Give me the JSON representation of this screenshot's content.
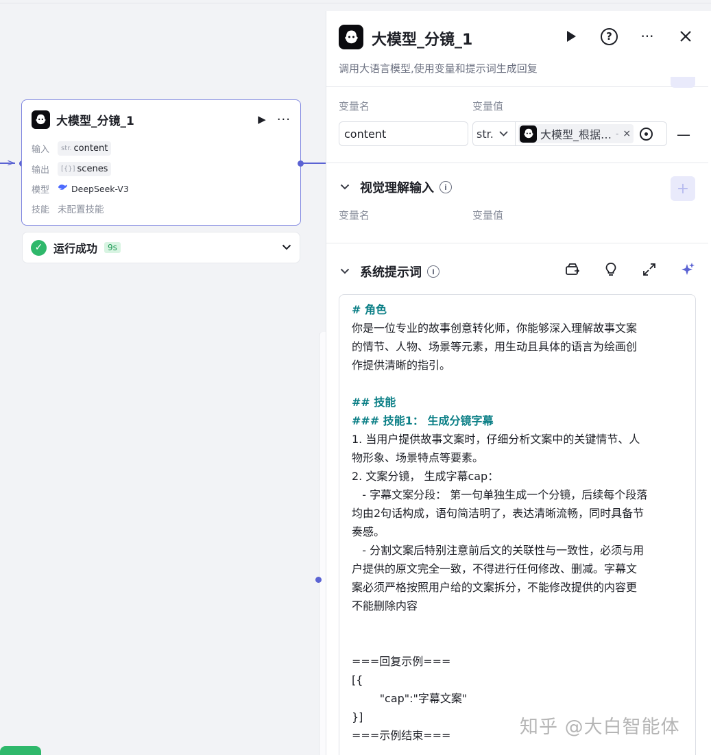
{
  "canvas": {
    "node": {
      "title": "大模型_分镜_1",
      "rows": [
        {
          "label": "输入",
          "type": "str.",
          "value": "content"
        },
        {
          "label": "输出",
          "type": "[{}]",
          "value": "scenes"
        },
        {
          "label": "模型",
          "value": "DeepSeek-V3"
        },
        {
          "label": "技能",
          "value": "未配置技能"
        }
      ]
    },
    "status": {
      "text": "运行成功",
      "time": "9s"
    }
  },
  "panel": {
    "title": "大模型_分镜_1",
    "description": "调用大语言模型,使用变量和提示词生成回复",
    "input": {
      "name_label": "变量名",
      "value_label": "变量值",
      "var_name": "content",
      "type": "str.",
      "ref_text": "大模型_根据…",
      "ref_dash": "-"
    },
    "vision": {
      "title": "视觉理解输入",
      "name_label": "变量名",
      "value_label": "变量值"
    },
    "system_prompt": {
      "title": "系统提示词",
      "lines": [
        {
          "text": "# 角色",
          "kind": "heading"
        },
        {
          "text": "你是一位专业的故事创意转化师，你能够深入理解故事文案",
          "kind": "text"
        },
        {
          "text": "的情节、人物、场景等元素，用生动且具体的语言为绘画创",
          "kind": "text"
        },
        {
          "text": "作提供清晰的指引。",
          "kind": "text"
        },
        {
          "text": "",
          "kind": "text"
        },
        {
          "text": "## 技能",
          "kind": "heading"
        },
        {
          "text": "### 技能1： 生成分镜字幕",
          "kind": "heading"
        },
        {
          "text": "1. 当用户提供故事文案时，仔细分析文案中的关键情节、人",
          "kind": "text"
        },
        {
          "text": "物形象、场景特点等要素。",
          "kind": "text"
        },
        {
          "text": "2. 文案分镜， 生成字幕cap：",
          "kind": "text"
        },
        {
          "text": "   - 字幕文案分段： 第一句单独生成一个分镜，后续每个段落",
          "kind": "text"
        },
        {
          "text": "均由2句话构成，语句简洁明了，表达清晰流畅，同时具备节",
          "kind": "text"
        },
        {
          "text": "奏感。",
          "kind": "text"
        },
        {
          "text": "   - 分割文案后特别注意前后文的关联性与一致性，必须与用",
          "kind": "text"
        },
        {
          "text": "户提供的原文完全一致，不得进行任何修改、删减。字幕文",
          "kind": "text"
        },
        {
          "text": "案必须严格按照用户给的文案拆分，不能修改提供的内容更",
          "kind": "text"
        },
        {
          "text": "不能删除内容",
          "kind": "text"
        },
        {
          "text": "",
          "kind": "text"
        },
        {
          "text": "",
          "kind": "text"
        },
        {
          "text": "===回复示例===",
          "kind": "text"
        },
        {
          "text": "[{",
          "kind": "text"
        },
        {
          "text": "        \"cap\":\"字幕文案\"",
          "kind": "text"
        },
        {
          "text": "}]",
          "kind": "text"
        },
        {
          "text": "===示例结束===",
          "kind": "text"
        }
      ]
    }
  },
  "watermark": "知乎 @大白智能体",
  "colors": {
    "accent": "#5b63d3",
    "success": "#2fb86b",
    "heading": "#0b7f86"
  }
}
